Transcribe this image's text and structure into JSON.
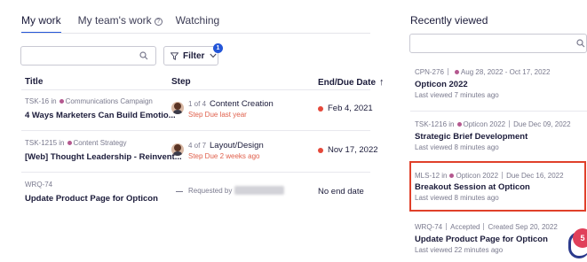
{
  "tabs": [
    {
      "label": "My work",
      "active": true
    },
    {
      "label": "My team's work",
      "has_help_icon": true
    },
    {
      "label": "Watching"
    }
  ],
  "filter": {
    "label": "Filter",
    "badge": "1"
  },
  "columns": {
    "title": "Title",
    "step": "Step",
    "due": "End/Due Date"
  },
  "rows": [
    {
      "id": "TSK-16",
      "in": "in",
      "campaign": "Communications Campaign",
      "title": "4 Ways Marketers Can Build Emotio...",
      "step_count": "1 of 4",
      "step_name": "Content Creation",
      "step_due": "Step Due last year",
      "due": "Feb 4, 2021",
      "overdue": true
    },
    {
      "id": "TSK-1215",
      "in": "in",
      "campaign": "Content Strategy",
      "title": "[Web] Thought Leadership - Reinvent...",
      "step_count": "4 of 7",
      "step_name": "Layout/Design",
      "step_due": "Step Due 2 weeks ago",
      "due": "Nov 17, 2022",
      "overdue": true
    },
    {
      "id": "WRQ-74",
      "title": "Update Product Page for Opticon",
      "requested_by": "Requested by",
      "due": "No end date"
    }
  ],
  "recently_viewed": {
    "heading": "Recently viewed",
    "items": [
      {
        "meta_id": "CPN-276",
        "meta_rest": "Aug 28, 2022 - Oct 17, 2022",
        "title": "Opticon 2022",
        "viewed": "Last viewed 7 minutes ago"
      },
      {
        "meta_id": "TSK-1216",
        "meta_in": "in",
        "meta_campaign": "Opticon 2022",
        "meta_due": "Due Dec 09, 2022",
        "title": "Strategic Brief Development",
        "viewed": "Last viewed 8 minutes ago"
      },
      {
        "meta_id": "MLS-12",
        "meta_in": "in",
        "meta_campaign": "Opticon 2022",
        "meta_due": "Due Dec 16, 2022",
        "title": "Breakout Session at Opticon",
        "viewed": "Last viewed 8 minutes ago",
        "highlighted": true
      },
      {
        "meta_id": "WRQ-74",
        "meta_status": "Accepted",
        "meta_created": "Created Sep 20, 2022",
        "title": "Update Product Page for Opticon",
        "viewed": "Last viewed 22 minutes ago"
      }
    ]
  },
  "chat_badge": "5",
  "colors": {
    "accent": "#2456d8",
    "overdue": "#e5483a",
    "campaign_dot": "#b4588f",
    "highlight": "#e0402a"
  }
}
